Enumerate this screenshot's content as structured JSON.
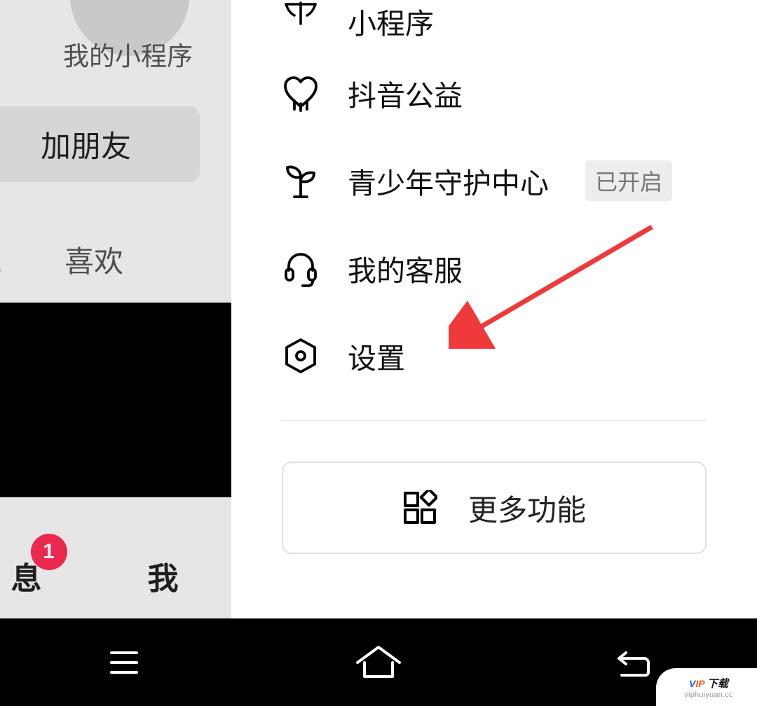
{
  "left_panel": {
    "my_miniprogram": "我的小程序",
    "add_friend": "加朋友",
    "tabs": {
      "favorites": "藏",
      "likes": "喜欢"
    },
    "bottom": {
      "messages": "息",
      "me": "我",
      "badge_count": "1"
    }
  },
  "drawer": {
    "items": [
      {
        "label": "小程序"
      },
      {
        "label": "抖音公益"
      },
      {
        "label": "青少年守护中心",
        "tag": "已开启"
      },
      {
        "label": "我的客服"
      },
      {
        "label": "设置"
      }
    ],
    "more": "更多功能"
  },
  "watermark": {
    "v": "V",
    "ip": "IP",
    "dl": "下载",
    "url": "viphuiyuan.cc"
  },
  "colors": {
    "badge": "#fa2c55",
    "arrow": "#ef3a3a"
  }
}
